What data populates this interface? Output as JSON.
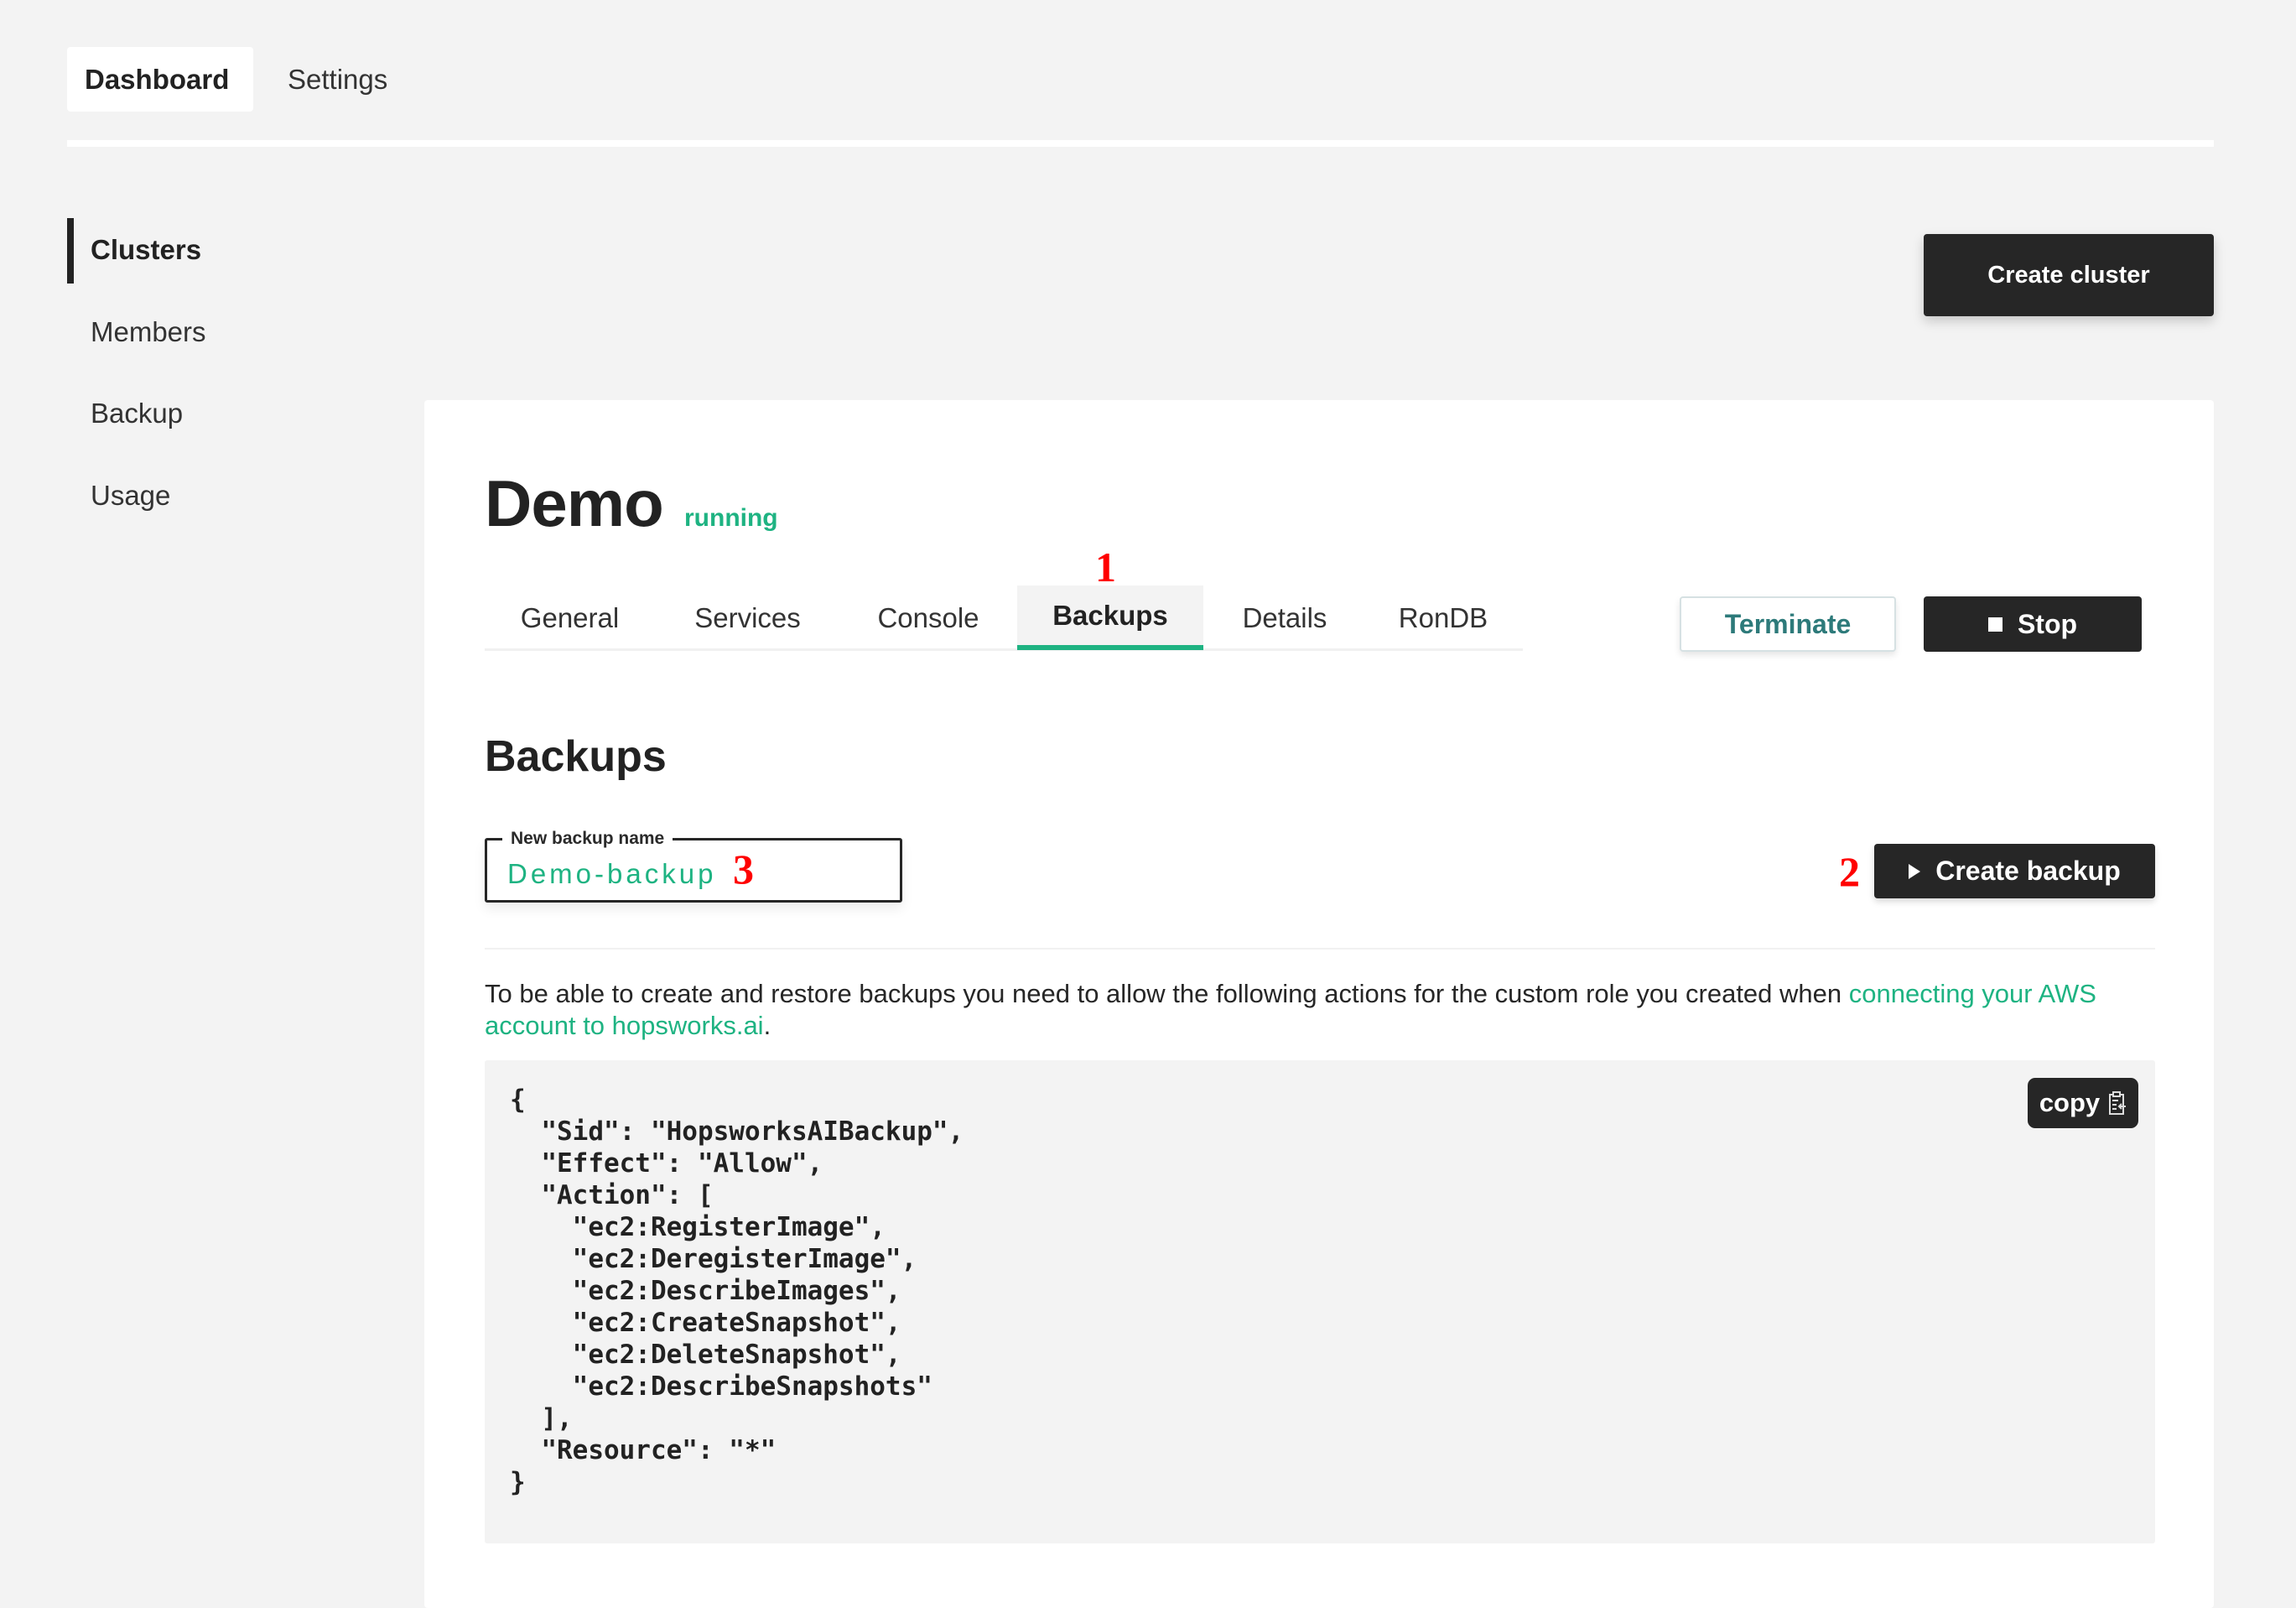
{
  "topnav": {
    "tabs": [
      {
        "label": "Dashboard",
        "active": true
      },
      {
        "label": "Settings",
        "active": false
      }
    ]
  },
  "sidebar": {
    "items": [
      {
        "label": "Clusters",
        "active": true
      },
      {
        "label": "Members",
        "active": false
      },
      {
        "label": "Backup",
        "active": false
      },
      {
        "label": "Usage",
        "active": false
      }
    ]
  },
  "header": {
    "create_cluster_label": "Create cluster"
  },
  "cluster": {
    "name": "Demo",
    "status": "running",
    "status_color": "#1eb382",
    "tabs": [
      {
        "label": "General",
        "active": false
      },
      {
        "label": "Services",
        "active": false
      },
      {
        "label": "Console",
        "active": false
      },
      {
        "label": "Backups",
        "active": true
      },
      {
        "label": "Details",
        "active": false
      },
      {
        "label": "RonDB",
        "active": false
      }
    ],
    "terminate_label": "Terminate",
    "stop_label": "Stop",
    "stop_icon": "stop-square-icon"
  },
  "backups": {
    "title": "Backups",
    "name_field": {
      "label": "New backup name",
      "value": "Demo-backup"
    },
    "create_backup_label": "Create backup",
    "create_backup_icon": "play-triangle-icon",
    "description_text": "To be able to create and restore backups you need to allow the following actions for the custom role you created when ",
    "description_link": "connecting your AWS account to hopsworks.ai",
    "description_end": ".",
    "policy_code": "{\n  \"Sid\": \"HopsworksAIBackup\",\n  \"Effect\": \"Allow\",\n  \"Action\": [\n    \"ec2:RegisterImage\",\n    \"ec2:DeregisterImage\",\n    \"ec2:DescribeImages\",\n    \"ec2:CreateSnapshot\",\n    \"ec2:DeleteSnapshot\",\n    \"ec2:DescribeSnapshots\"\n  ],\n  \"Resource\": \"*\"\n}",
    "copy_label": "copy",
    "copy_icon": "clipboard-icon"
  },
  "annotations": {
    "one": "1",
    "two": "2",
    "three": "3"
  },
  "colors": {
    "accent": "#1eb382",
    "dark": "#262626",
    "terminate_text": "#2d7a7a",
    "background": "#f3f3f3"
  }
}
